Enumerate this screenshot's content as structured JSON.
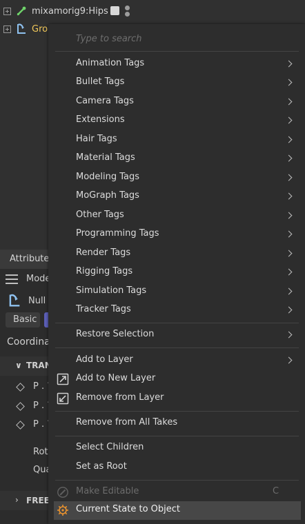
{
  "object_manager": {
    "rows": [
      {
        "name": "mixamorig9:Hips",
        "icon": "bone-icon"
      },
      {
        "name": "Gro",
        "icon": "null-object-icon"
      }
    ]
  },
  "attribute_manager": {
    "tab": "Attribute",
    "mode_label": "Mode",
    "object_type": "Null",
    "basic_button": "Basic",
    "coordinates_label": "Coordina",
    "transform_section": "TRAN",
    "position_rows": [
      "P . ?",
      "P . ?",
      "P . ?"
    ],
    "rot_label": "Rot",
    "qua_label": "Qua",
    "freeze_section": "FREEZ"
  },
  "context_menu": {
    "search_placeholder": "Type to search",
    "tag_items": [
      "Animation Tags",
      "Bullet Tags",
      "Camera Tags",
      "Extensions",
      "Hair Tags",
      "Material Tags",
      "Modeling Tags",
      "MoGraph Tags",
      "Other Tags",
      "Programming Tags",
      "Render Tags",
      "Rigging Tags",
      "Simulation Tags",
      "Tracker Tags"
    ],
    "restore_selection": "Restore Selection",
    "add_to_layer": "Add to Layer",
    "add_to_new_layer": "Add to New Layer",
    "remove_from_layer": "Remove from Layer",
    "remove_from_all_takes": "Remove from All Takes",
    "select_children": "Select Children",
    "set_as_root": "Set as Root",
    "make_editable": "Make Editable",
    "make_editable_shortcut": "C",
    "current_state_to_object": "Current State to Object"
  },
  "colors": {
    "accent_orange": "#e8922f",
    "object_name_yellow": "#f0c75a",
    "bone_green": "#6fd36a",
    "null_blue": "#8fc2f0"
  }
}
